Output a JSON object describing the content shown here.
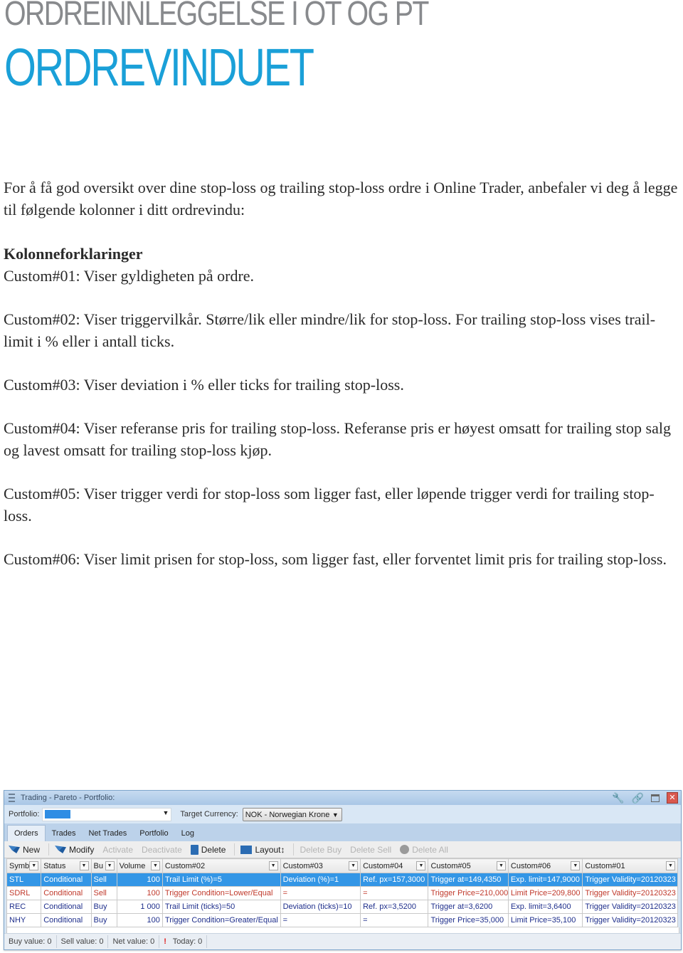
{
  "header": {
    "supertitle": "ORDREINNLEGGELSE I OT OG PT",
    "title": "ORDREVINDUET",
    "title_color": "#1aa0d8",
    "supertitle_color": "#888a8d"
  },
  "document": {
    "intro": "For å få god oversikt over dine stop-loss og trailing stop-loss ordre i Online Trader, anbefaler vi deg å legge til følgende kolonner i ditt ordrevindu:",
    "section_heading": "Kolonneforklaringer",
    "explanations": [
      "Custom#01: Viser gyldigheten på ordre.",
      "Custom#02: Viser triggervilkår. Større/lik eller mindre/lik for stop-loss. For trailing stop-loss vises trail-limit i % eller i antall ticks.",
      "Custom#03: Viser deviation i % eller ticks for trailing stop-loss.",
      "Custom#04: Viser referanse pris for trailing stop-loss. Referanse pris er høyest omsatt for trailing stop salg og lavest omsatt for trailing stop-loss kjøp.",
      "Custom#05: Viser trigger verdi for stop-loss som ligger fast, eller løpende trigger verdi for trailing stop-loss.",
      "Custom#06: Viser limit prisen for stop-loss, som ligger fast, eller forventet limit pris for trailing stop-loss."
    ]
  },
  "window": {
    "title": "Trading - Pareto - Portfolio:",
    "title_icons": [
      "menu-icon",
      "wrench-icon",
      "link-icon",
      "restore-icon",
      "close-icon"
    ],
    "portfolio_label": "Portfolio:",
    "portfolio_value": "",
    "target_currency_label": "Target Currency:",
    "target_currency_value": "NOK - Norwegian Krone",
    "tabs": [
      {
        "label": "Orders",
        "active": true
      },
      {
        "label": "Trades",
        "active": false
      },
      {
        "label": "Net Trades",
        "active": false
      },
      {
        "label": "Portfolio",
        "active": false
      },
      {
        "label": "Log",
        "active": false
      }
    ],
    "toolbar": {
      "new": "New",
      "modify": "Modify",
      "activate": "Activate",
      "deactivate": "Deactivate",
      "delete": "Delete",
      "layout": "Layout",
      "delete_buy": "Delete Buy",
      "delete_sell": "Delete Sell",
      "delete_all": "Delete All"
    },
    "columns": [
      "Symb",
      "Status",
      "Bu",
      "Volume",
      "Custom#02",
      "Custom#03",
      "Custom#04",
      "Custom#05",
      "Custom#06",
      "Custom#01"
    ],
    "rows": [
      {
        "symbol": "STL",
        "status": "Conditional",
        "side": "Sell",
        "volume": "100",
        "c02": "Trail Limit (%)=5",
        "c03": "Deviation (%)=1",
        "c04": "Ref. px=157,3000",
        "c05": "Trigger at=149,4350",
        "c06": "Exp. limit=147,9000",
        "c01": "Trigger Validity=20120323",
        "state": "selected"
      },
      {
        "symbol": "SDRL",
        "status": "Conditional",
        "side": "Sell",
        "volume": "100",
        "c02": "Trigger Condition=Lower/Equal",
        "c03": "=",
        "c04": "=",
        "c05": "Trigger Price=210,000",
        "c06": "Limit Price=209,800",
        "c01": "Trigger Validity=20120323",
        "state": "sell"
      },
      {
        "symbol": "REC",
        "status": "Conditional",
        "side": "Buy",
        "volume": "1 000",
        "c02": "Trail Limit (ticks)=50",
        "c03": "Deviation (ticks)=10",
        "c04": "Ref. px=3,5200",
        "c05": "Trigger at=3,6200",
        "c06": "Exp. limit=3,6400",
        "c01": "Trigger Validity=20120323",
        "state": "buy"
      },
      {
        "symbol": "NHY",
        "status": "Conditional",
        "side": "Buy",
        "volume": "100",
        "c02": "Trigger Condition=Greater/Equal",
        "c03": "=",
        "c04": "=",
        "c05": "Trigger Price=35,000",
        "c06": "Limit Price=35,100",
        "c01": "Trigger Validity=20120323",
        "state": "buy"
      }
    ],
    "status_bar": {
      "buy_value": "Buy value: 0",
      "sell_value": "Sell value: 0",
      "net_value": "Net value: 0",
      "warning_glyph": "!",
      "today": "Today: 0"
    },
    "colors": {
      "selected_row": "#3396e6",
      "sell_text": "#c0392b",
      "buy_text": "#1f2f8c"
    }
  }
}
